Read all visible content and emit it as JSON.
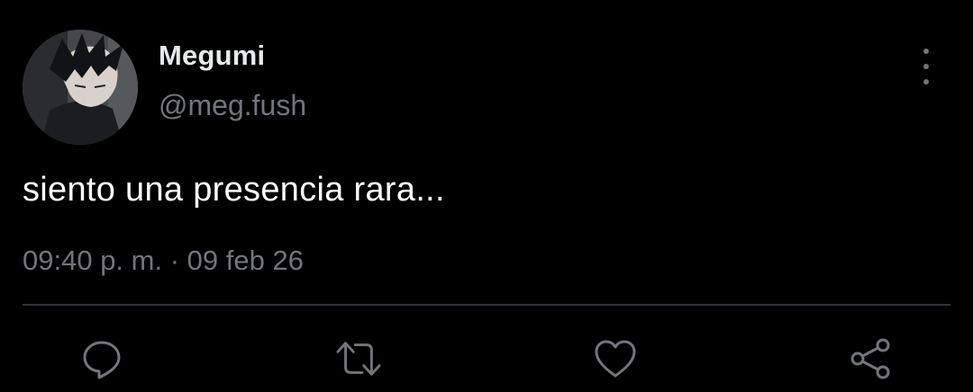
{
  "tweet": {
    "author": {
      "display_name": "Megumi",
      "handle": "@meg.fush"
    },
    "text": "siento una presencia rara...",
    "time": "09:40 p. m.",
    "separator": "·",
    "date": "09 feb 26"
  },
  "icons": {
    "more": "more-vertical-icon",
    "reply": "reply-icon",
    "retweet": "retweet-icon",
    "like": "heart-icon",
    "share": "share-icon"
  },
  "colors": {
    "background": "#000000",
    "text": "#ffffff",
    "secondary": "#71767b",
    "divider": "#2f3336"
  }
}
